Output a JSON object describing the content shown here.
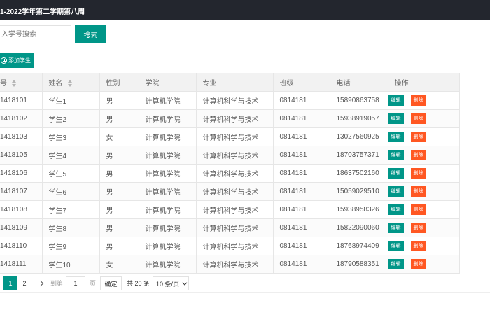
{
  "header": {
    "title": "1-2022学年第二学期第八周"
  },
  "search": {
    "placeholder": "入学号搜索",
    "button_label": "搜索"
  },
  "toolbar": {
    "add_label": "添加学生"
  },
  "table": {
    "columns": [
      "号",
      "姓名",
      "性别",
      "学院",
      "专业",
      "班级",
      "电话",
      "操作"
    ],
    "edit_label": "编辑",
    "delete_label": "删除",
    "rows": [
      [
        "1418101",
        "学生1",
        "男",
        "计算机学院",
        "计算机科学与技术",
        "0814181",
        "15890863758"
      ],
      [
        "1418102",
        "学生2",
        "男",
        "计算机学院",
        "计算机科学与技术",
        "0814181",
        "15938919057"
      ],
      [
        "1418103",
        "学生3",
        "女",
        "计算机学院",
        "计算机科学与技术",
        "0814181",
        "13027560925"
      ],
      [
        "1418105",
        "学生4",
        "男",
        "计算机学院",
        "计算机科学与技术",
        "0814181",
        "18703757371"
      ],
      [
        "1418106",
        "学生5",
        "男",
        "计算机学院",
        "计算机科学与技术",
        "0814181",
        "18637502160"
      ],
      [
        "1418107",
        "学生6",
        "男",
        "计算机学院",
        "计算机科学与技术",
        "0814181",
        "15059029510"
      ],
      [
        "1418108",
        "学生7",
        "男",
        "计算机学院",
        "计算机科学与技术",
        "0814181",
        "15938958326"
      ],
      [
        "1418109",
        "学生8",
        "男",
        "计算机学院",
        "计算机科学与技术",
        "0814181",
        "15822090060"
      ],
      [
        "1418110",
        "学生9",
        "男",
        "计算机学院",
        "计算机科学与技术",
        "0814181",
        "18768974409"
      ],
      [
        "1418111",
        "学生10",
        "女",
        "计算机学院",
        "计算机科学与技术",
        "0814181",
        "18790588351"
      ]
    ]
  },
  "pager": {
    "page1": "1",
    "page2": "2",
    "goto_label": "到第",
    "goto_value": "1",
    "page_unit": "页",
    "confirm_label": "确定",
    "total_label": "共 20 条",
    "page_size_label": "10 条/页"
  },
  "colors": {
    "primary": "#009688",
    "danger": "#ff5722",
    "header_bg": "#23262e"
  }
}
